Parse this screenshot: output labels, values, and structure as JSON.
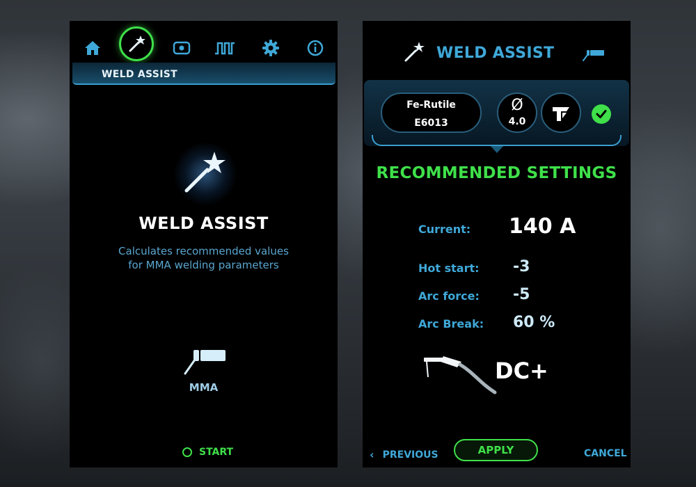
{
  "left": {
    "nav": {
      "items": [
        {
          "icon": "home-icon"
        },
        {
          "icon": "weld-assist-wand-icon",
          "active": true
        },
        {
          "icon": "memory-icon"
        },
        {
          "icon": "pulse-icon"
        },
        {
          "icon": "gear-icon"
        },
        {
          "icon": "info-icon"
        }
      ],
      "active_title": "WELD ASSIST"
    },
    "hero": {
      "title": "WELD ASSIST",
      "description_line1": "Calculates recommended values",
      "description_line2": "for MMA welding parameters"
    },
    "process_label": "MMA",
    "start_label": "START"
  },
  "right": {
    "header_title": "WELD ASSIST",
    "electrode": {
      "name": "Fe-Rutile",
      "code": "E6013"
    },
    "diameter": {
      "symbol": "Ø",
      "value": "4.0"
    },
    "recommended_title": "RECOMMENDED SETTINGS",
    "params": [
      {
        "label": "Current:",
        "value": "140 A"
      },
      {
        "label": "Hot start:",
        "value": "-3"
      },
      {
        "label": "Arc force:",
        "value": "-5"
      },
      {
        "label": "Arc Break:",
        "value": "60 %"
      }
    ],
    "polarity": "DC+",
    "previous_label": "PREVIOUS",
    "apply_label": "APPLY",
    "cancel_label": "CANCEL"
  },
  "colors": {
    "accent_blue": "#3fa8d8",
    "accent_green": "#3fe04a",
    "panel_bg": "#000000"
  }
}
